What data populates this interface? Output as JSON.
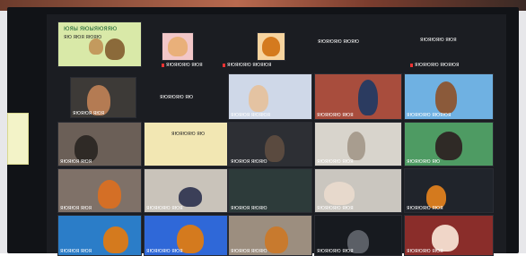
{
  "meeting": {
    "featured_title": "ЮЯЫ ЯЮЫЯЮЯЯЮ",
    "featured_sub": "ЯЮ ЯЮЯ ЯЮЯЮ",
    "names": {
      "r1c3": "ЯЮЯЮЯЮ ЯЮЯ",
      "r1c4": "ЯЮЯЮЯЮ ЯЮЯЮЯ",
      "r1c5": "ЯЮЯЮЯЮ ЯЮЯЮ",
      "r1c6": "ЯЮЯЮЯЮ ЯЮЯ",
      "r1c7": "ЯЮЯЮЯЮ ЯЮЯЮЯ",
      "r2c2": "ЯЮЯЮЯ ЯЮЯ",
      "r2c3": "ЯЮЯЮЯЮ ЯЮ",
      "r2c4": "ЯЮЯЮЯ ЯЮЯЮЯ",
      "r2c5": "ЯЮЯЮЯЮ ЯЮЯ",
      "r2c6": "ЯЮЯЮЯЮ ЯЮЯЮЯ",
      "r3c1": "ЯЮЯЮЯ ЯЮЯ",
      "r3c2": "ЯЮЯЮЯЮ ЯЮ",
      "r3c3": "ЯЮЯЮЯ ЯЮЯЮ",
      "r3c4": "ЯЮЯЮЯЮ ЯЮЯ",
      "r3c5": "ЯЮЯЮЯЮ ЯЮ",
      "r4c1": "ЯЮЯЮЯ ЯЮЯ",
      "r4c2": "ЯЮЯЮЯЮ ЯЮЯ",
      "r4c3": "ЯЮЯЮЯ ЯЮЯЮ",
      "r4c4": "ЯЮЯЮЯЮ ЯЮЯ",
      "r4c5": "ЯЮЯЮЯЮ ЯЮЯ",
      "r5c1": "ЯЮЯЮЯ ЯЮЯ",
      "r5c2": "ЯЮЯЮЯЮ ЯЮЯ",
      "r5c3": "ЯЮЯЮЯ ЯЮЯЮ",
      "r5c4": "ЯЮЯЮЯЮ ЯЮЯ",
      "r5c5": "ЯЮЯЮЯЮ ЯЮЯ"
    }
  },
  "colors": {
    "screen": "#1b1d22",
    "tile_border": "#2a2c33",
    "accent_green": "#0f4b2a",
    "accent_orange": "#d47a1e",
    "accent_blue": "#2f68d8"
  }
}
